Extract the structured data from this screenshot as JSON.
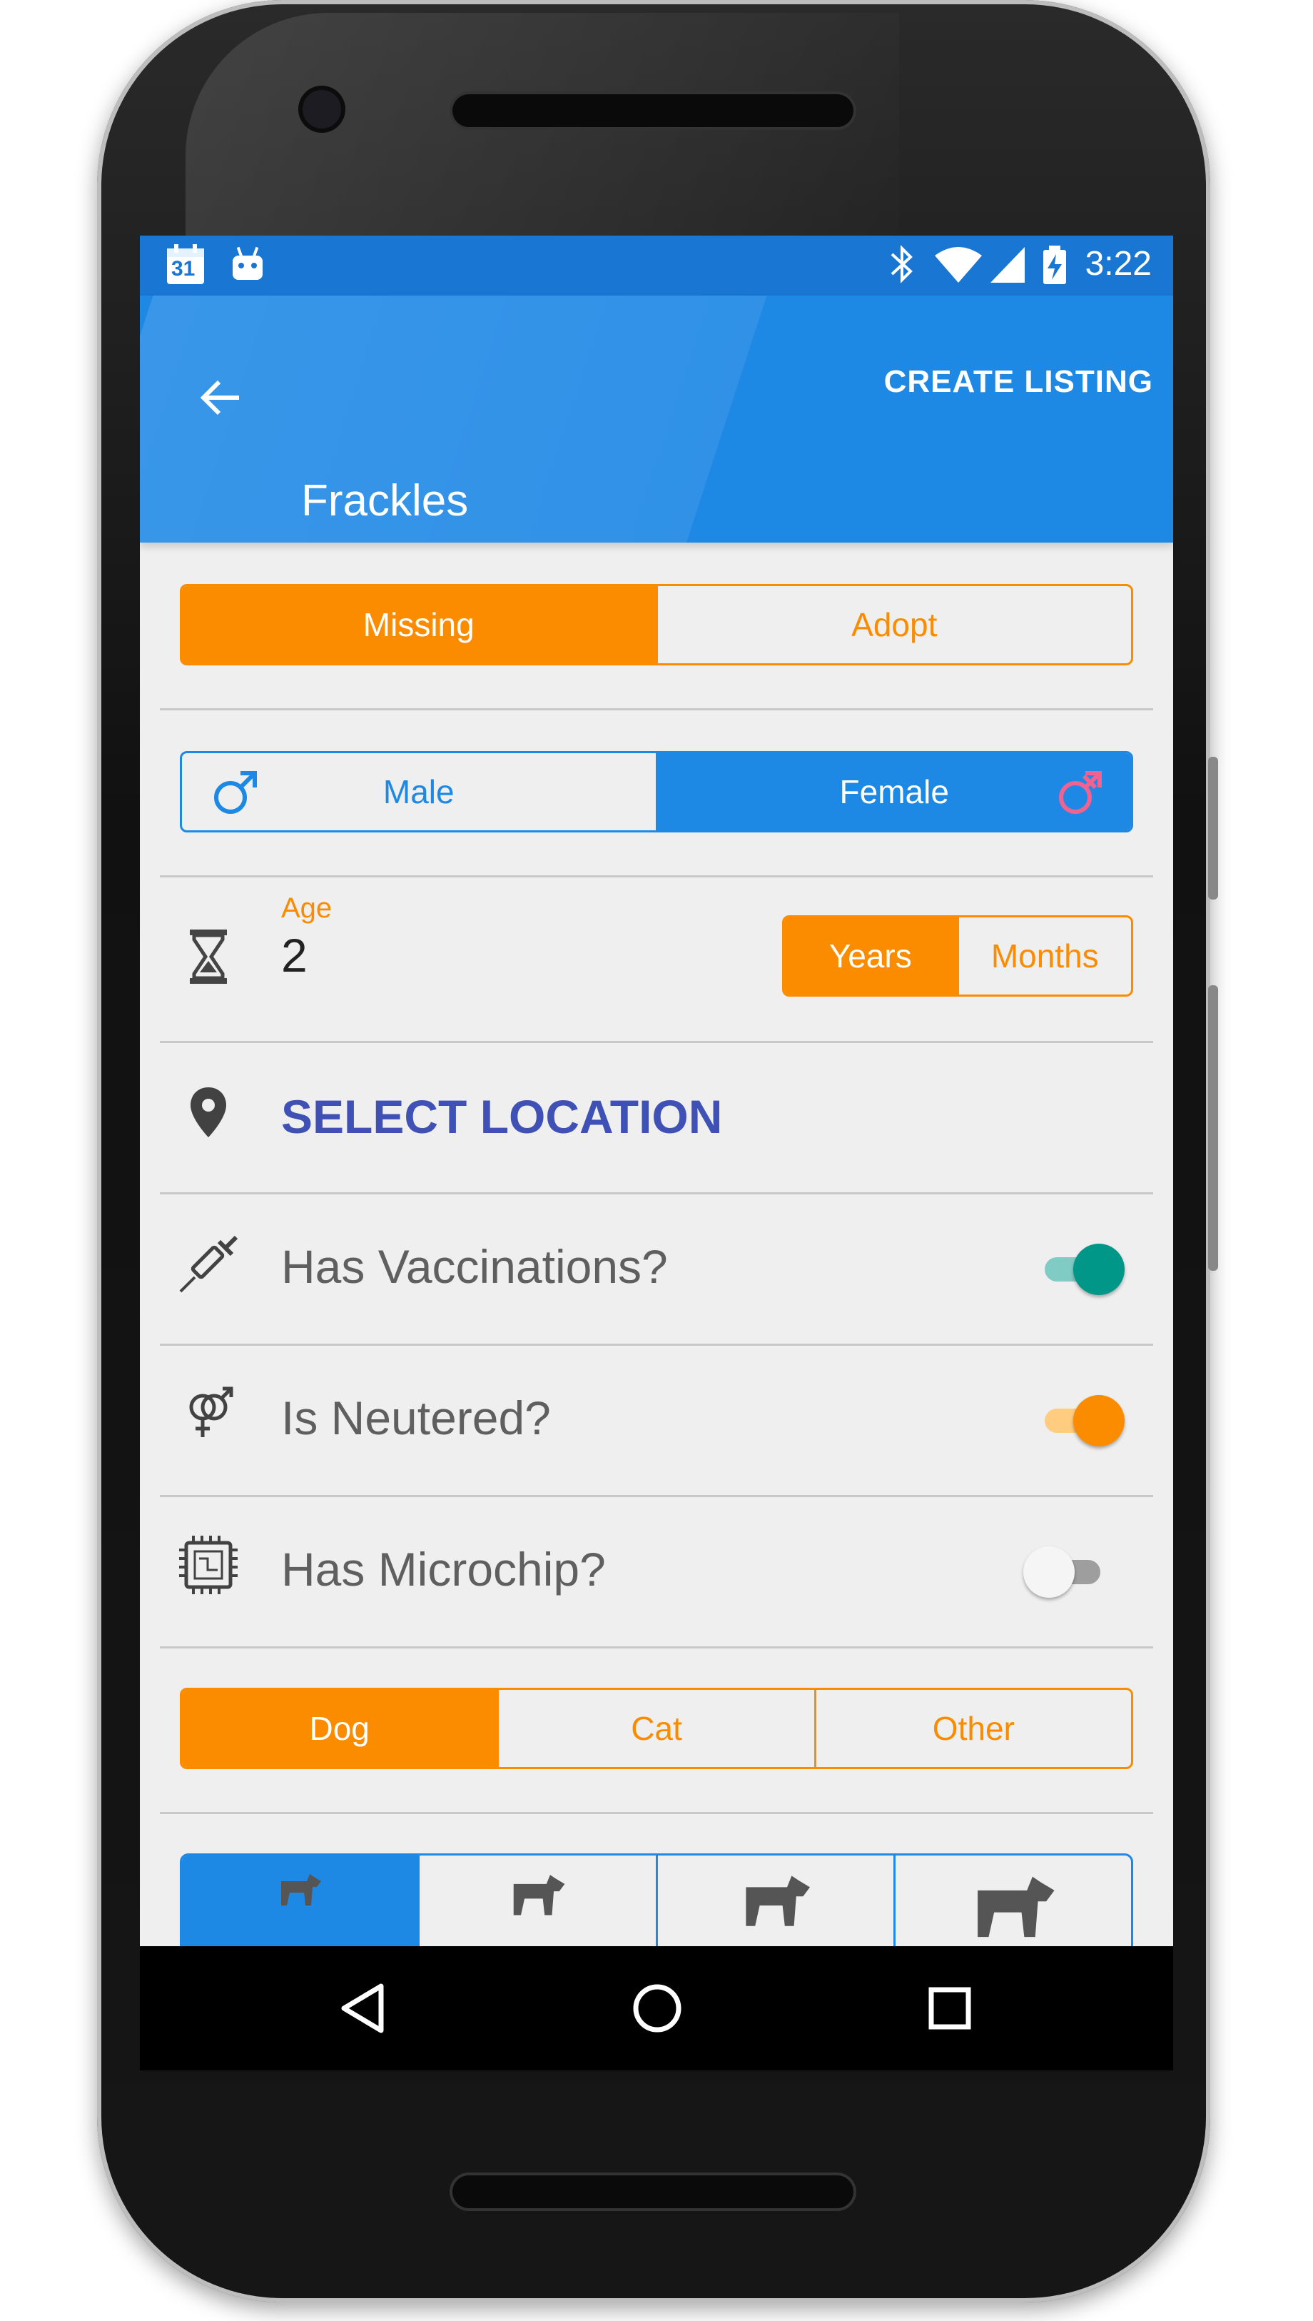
{
  "status_bar": {
    "time": "3:22",
    "calendar_day": "31",
    "icons": [
      "calendar-icon",
      "android-icon",
      "bluetooth-icon",
      "wifi-icon",
      "cellular-signal-icon",
      "battery-charging-icon"
    ]
  },
  "app_bar": {
    "action": "CREATE LISTING",
    "title": "Frackles"
  },
  "listing_type": {
    "options": [
      "Missing",
      "Adopt"
    ],
    "selected": "Missing"
  },
  "gender": {
    "options": [
      "Male",
      "Female"
    ],
    "selected": "Female"
  },
  "age": {
    "label": "Age",
    "value": "2",
    "units": [
      "Years",
      "Months"
    ],
    "selected_unit": "Years"
  },
  "location": {
    "label": "SELECT LOCATION"
  },
  "toggles": [
    {
      "label": "Has Vaccinations?",
      "on": true,
      "color": "#009688"
    },
    {
      "label": "Is Neutered?",
      "on": true,
      "color": "#fb8c00"
    },
    {
      "label": "Has Microchip?",
      "on": false,
      "color": "#9e9e9e"
    }
  ],
  "species": {
    "options": [
      "Dog",
      "Cat",
      "Other"
    ],
    "selected": "Dog"
  },
  "pet_size": {
    "icons": [
      "small-dog-icon",
      "medium-dog-icon",
      "large-dog-icon",
      "xlarge-dog-icon"
    ],
    "selected_index": 0
  },
  "colors": {
    "primary": "#1e88e5",
    "primary_dark": "#1976d2",
    "accent": "#fb8c00",
    "teal": "#009688",
    "location_text": "#3f51b5",
    "male_icon": "#1e88e5",
    "female_icon": "#f06292"
  }
}
